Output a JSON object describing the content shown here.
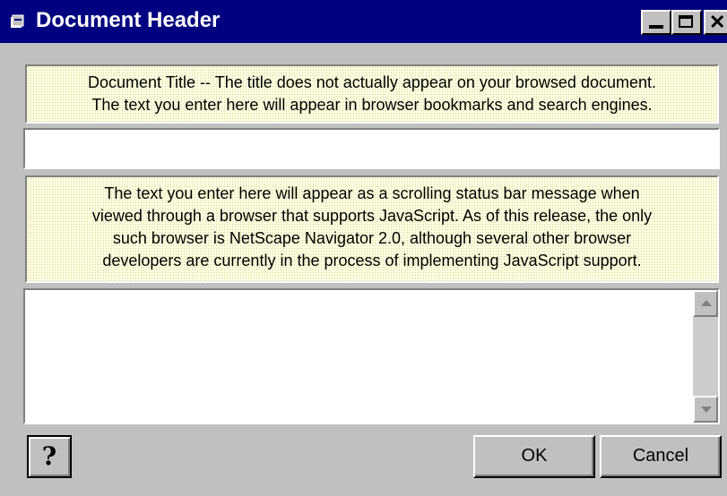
{
  "window": {
    "title": "Document Header",
    "controls": {
      "minimize_icon": "minimize-icon",
      "maximize_icon": "maximize-icon",
      "close_glyph": "✕"
    }
  },
  "title_section": {
    "description_line1": "Document Title -- The title does not actually appear on your browsed document.",
    "description_line2": "The text you enter here will appear in browser bookmarks and search engines.",
    "input_value": ""
  },
  "status_section": {
    "description_line1": "The text you enter here will appear as a scrolling status bar message when",
    "description_line2": "viewed through a browser that supports JavaScript.  As of this release, the only",
    "description_line3": "such browser is NetScape Navigator 2.0, although several other browser",
    "description_line4": "developers are currently in the process of implementing JavaScript support.",
    "textarea_value": ""
  },
  "buttons": {
    "help_glyph": "?",
    "ok_label": "OK",
    "cancel_label": "Cancel"
  },
  "colors": {
    "titlebar": "#000080",
    "window_bg": "#c0c0c0",
    "help_box_bg": "#ffffe0"
  }
}
